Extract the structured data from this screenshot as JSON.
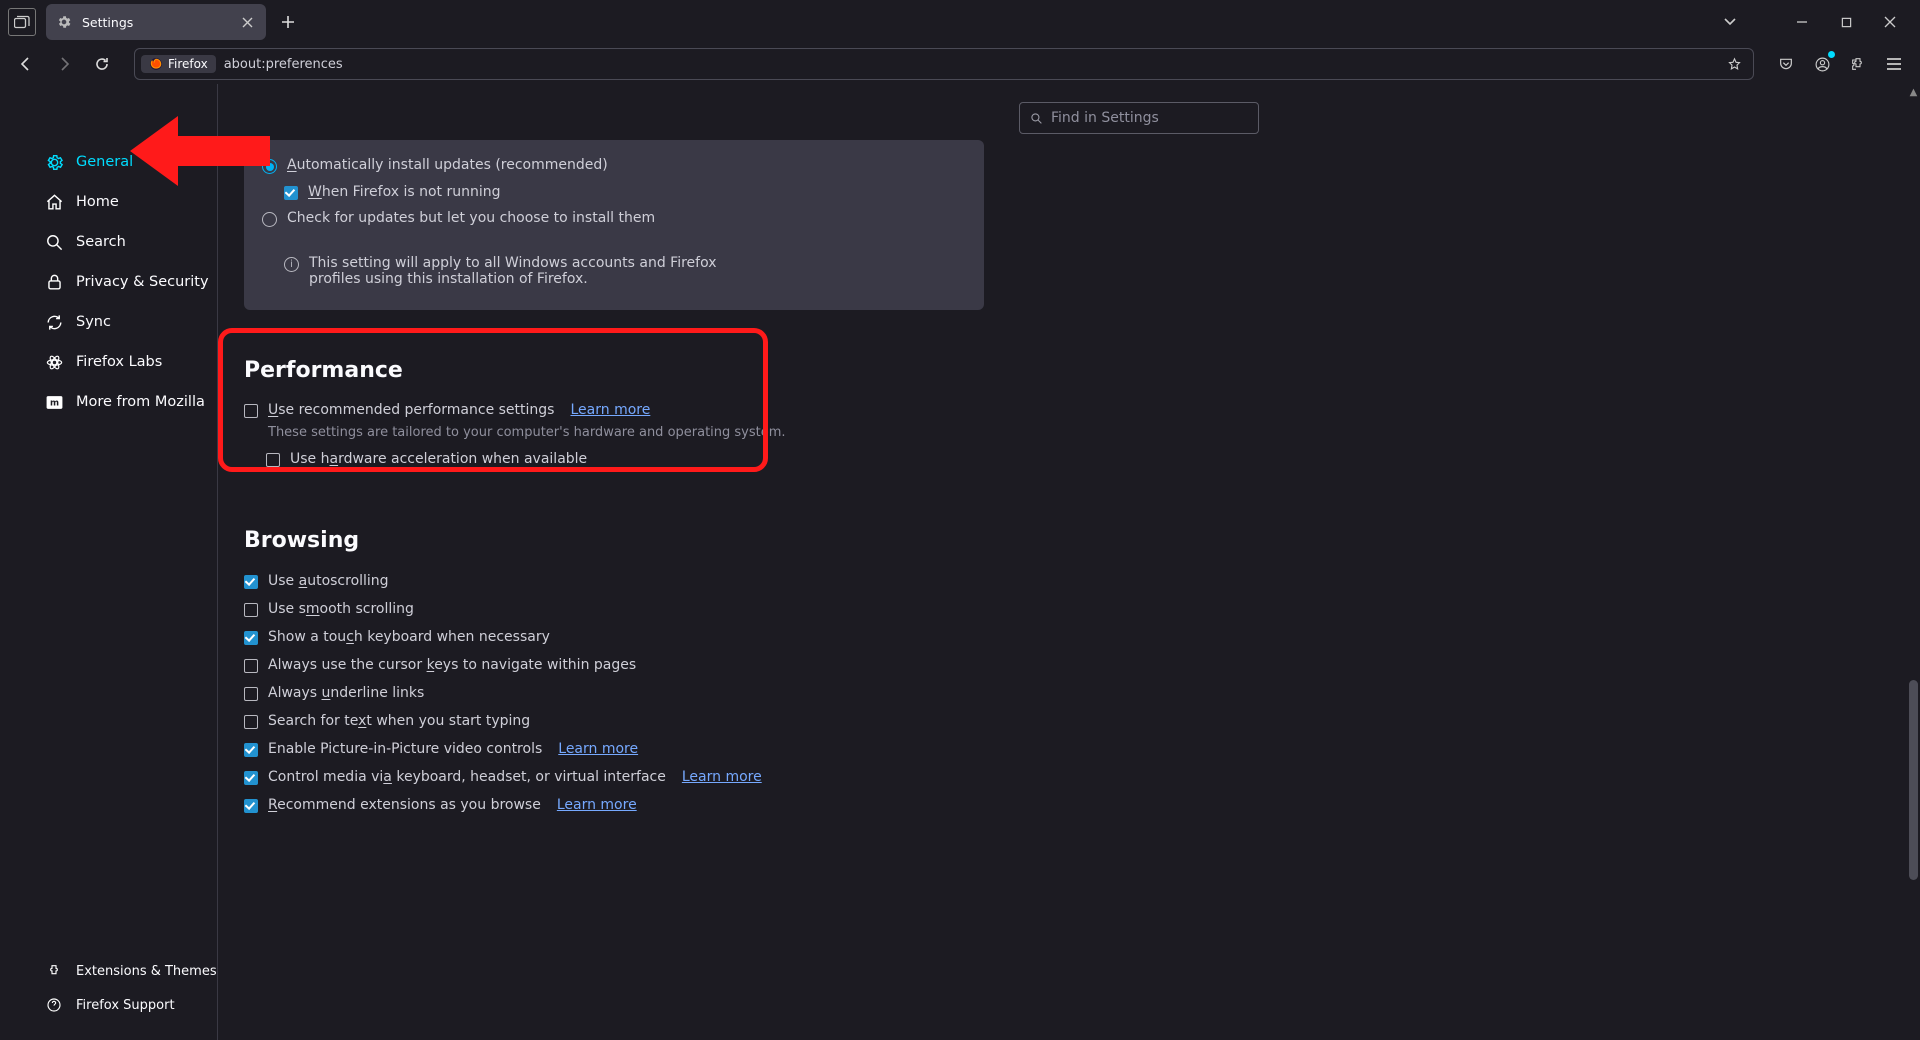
{
  "tab": {
    "title": "Settings"
  },
  "url": {
    "badge": "Firefox",
    "path": "about:preferences"
  },
  "search": {
    "placeholder": "Find in Settings"
  },
  "sidebar": {
    "items": [
      {
        "label": "General",
        "icon": "gear"
      },
      {
        "label": "Home",
        "icon": "home"
      },
      {
        "label": "Search",
        "icon": "search"
      },
      {
        "label": "Privacy & Security",
        "icon": "lock"
      },
      {
        "label": "Sync",
        "icon": "sync"
      },
      {
        "label": "Firefox Labs",
        "icon": "labs"
      },
      {
        "label": "More from Mozilla",
        "icon": "moz"
      }
    ],
    "footer": [
      {
        "label": "Extensions & Themes",
        "icon": "puzzle"
      },
      {
        "label": "Firefox Support",
        "icon": "help"
      }
    ]
  },
  "updates": {
    "auto_label": "Automatically install updates (recommended)",
    "when_label": "When Firefox is not running",
    "check_label": "Check for updates but let you choose to install them",
    "note": "This setting will apply to all Windows accounts and Firefox profiles using this installation of Firefox."
  },
  "performance": {
    "heading": "Performance",
    "use_rec": "Use recommended performance settings",
    "learn": "Learn more",
    "note": "These settings are tailored to your computer's hardware and operating system.",
    "hw_accel": "Use hardware acceleration when available"
  },
  "browsing": {
    "heading": "Browsing",
    "items": [
      {
        "label": "Use autoscrolling",
        "checked": true
      },
      {
        "label": "Use smooth scrolling",
        "checked": false
      },
      {
        "label": "Show a touch keyboard when necessary",
        "checked": true
      },
      {
        "label": "Always use the cursor keys to navigate within pages",
        "checked": false
      },
      {
        "label": "Always underline links",
        "checked": false
      },
      {
        "label": "Search for text when you start typing",
        "checked": false
      },
      {
        "label": "Enable Picture-in-Picture video controls",
        "checked": true,
        "learn": "Learn more"
      },
      {
        "label": "Control media via keyboard, headset, or virtual interface",
        "checked": true,
        "learn": "Learn more"
      },
      {
        "label": "Recommend extensions as you browse",
        "checked": true,
        "learn": "Learn more"
      }
    ]
  }
}
